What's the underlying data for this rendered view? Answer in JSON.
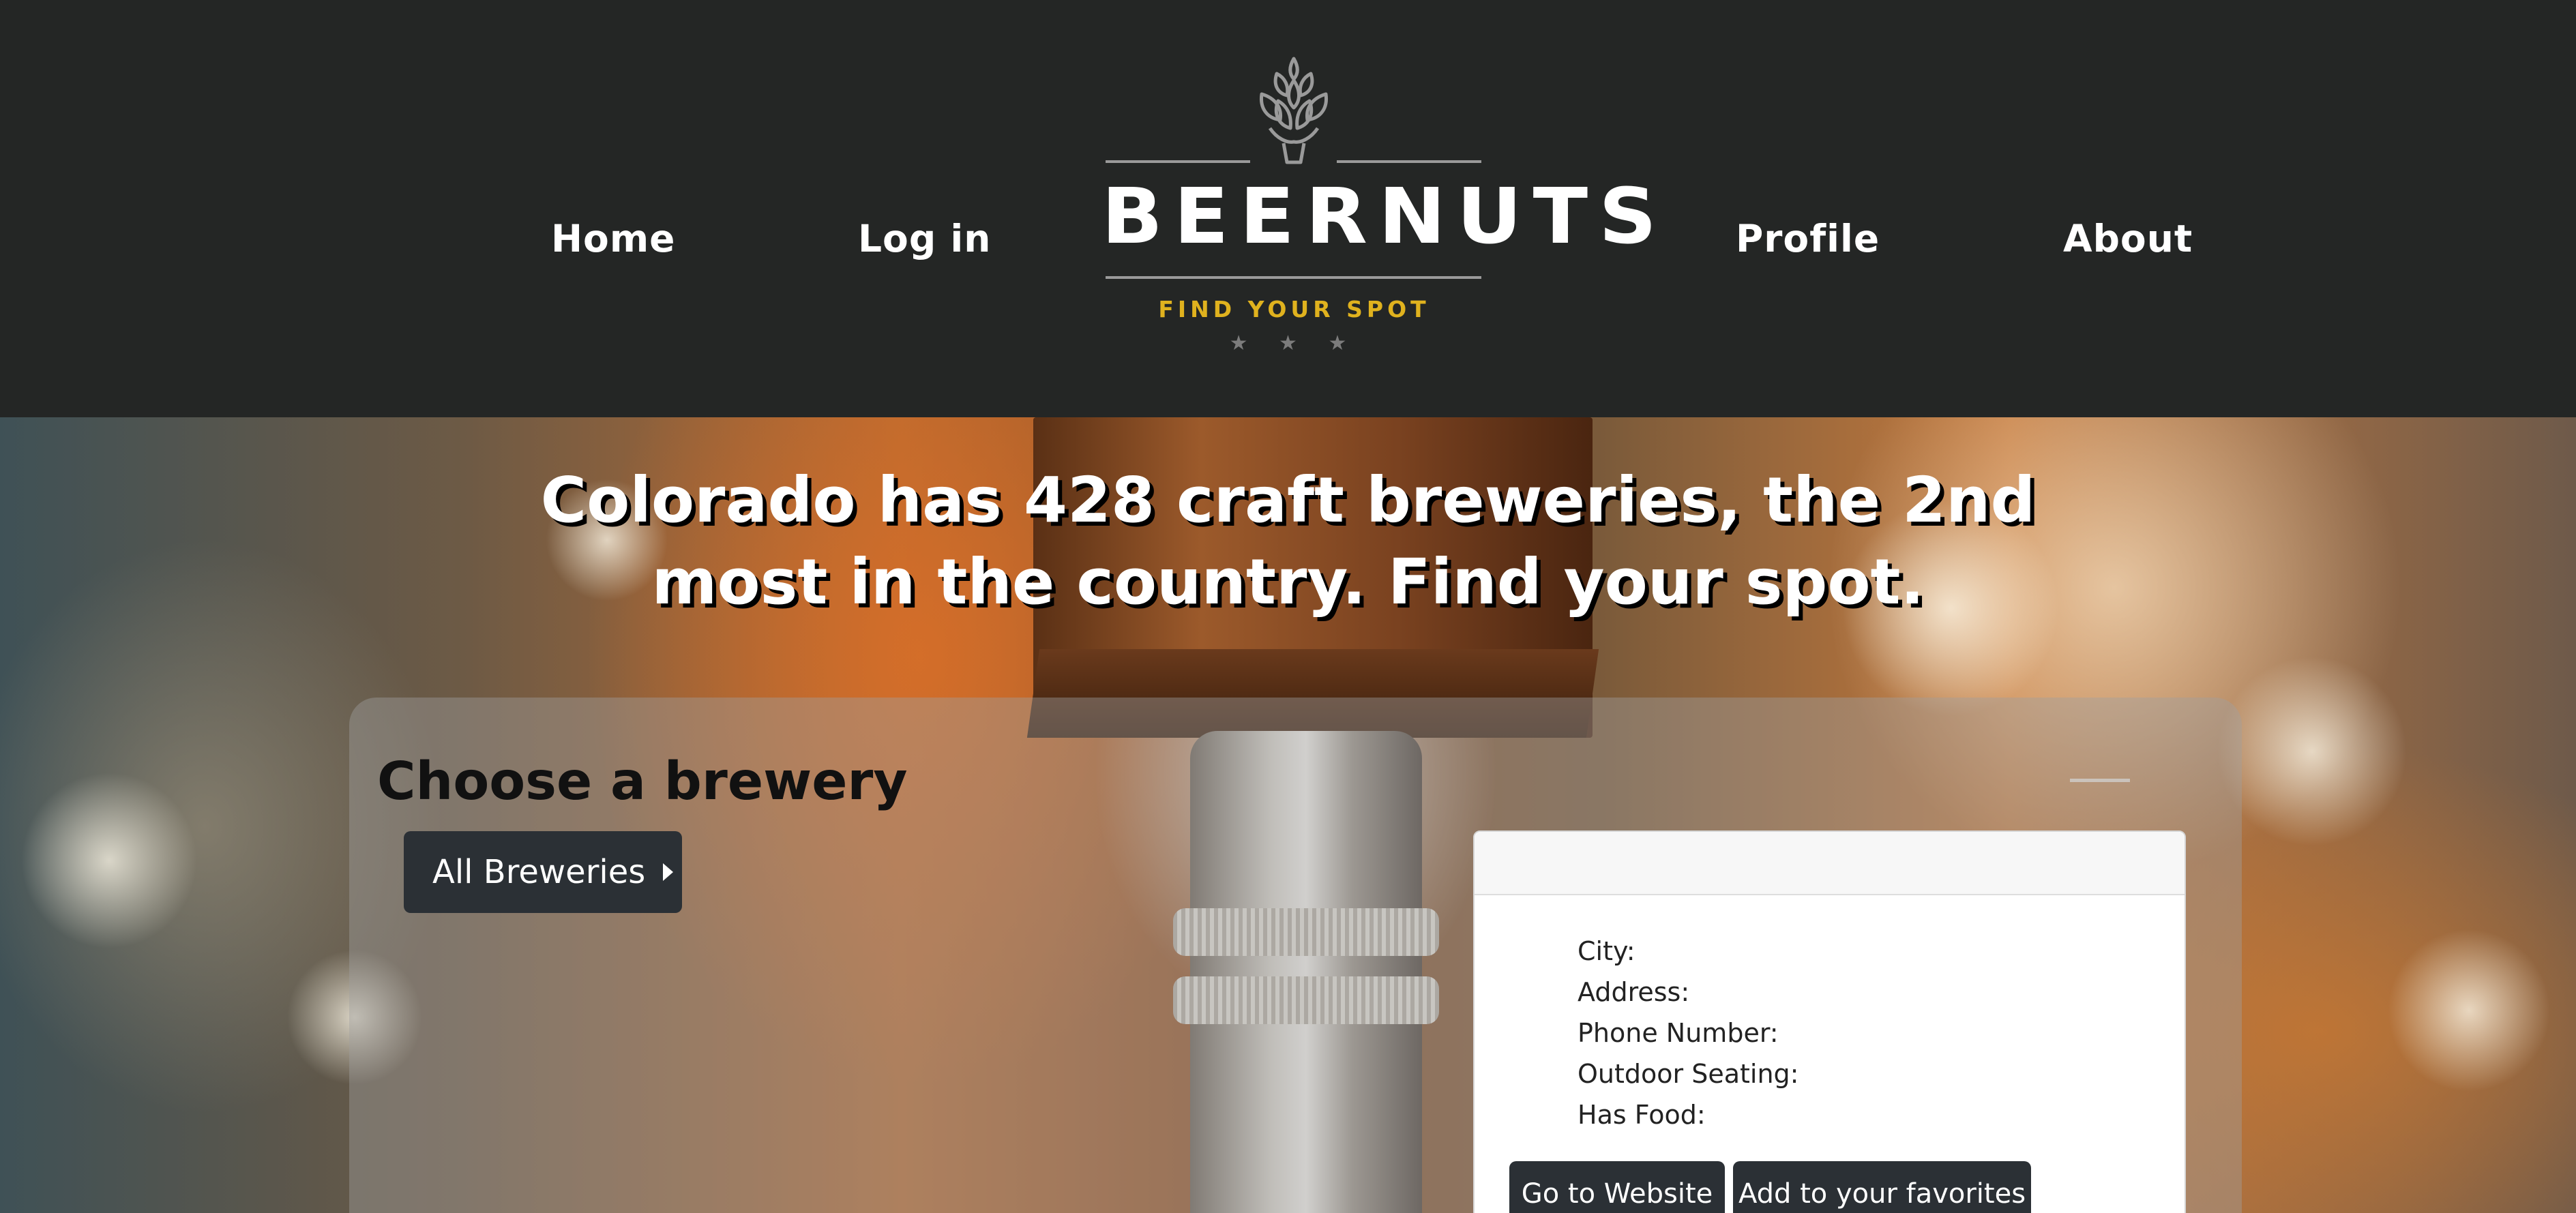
{
  "nav": {
    "home": "Home",
    "login": "Log in",
    "profile": "Profile",
    "about": "About"
  },
  "logo": {
    "wordmark": "BEERNUTS",
    "tagline": "FIND YOUR SPOT",
    "stars": "★ ★ ★",
    "icon": "hop-cone-icon"
  },
  "hero": {
    "title": "Colorado has 428 craft breweries, the 2nd most in the country. Find your spot."
  },
  "selector": {
    "heading": "Choose a brewery",
    "dropdown_label": "All Breweries",
    "dropdown_icon": "caret-right-icon"
  },
  "details": {
    "header": "",
    "city": "City:",
    "address": "Address:",
    "phone": "Phone Number:",
    "outdoor": "Outdoor Seating:",
    "food": "Has Food:",
    "website_button": "Go to Website",
    "favorites_button": "Add to your favorites"
  },
  "colors": {
    "header_bg": "#242625",
    "button_bg": "#2b3035",
    "tagline": "#e0b21e"
  }
}
